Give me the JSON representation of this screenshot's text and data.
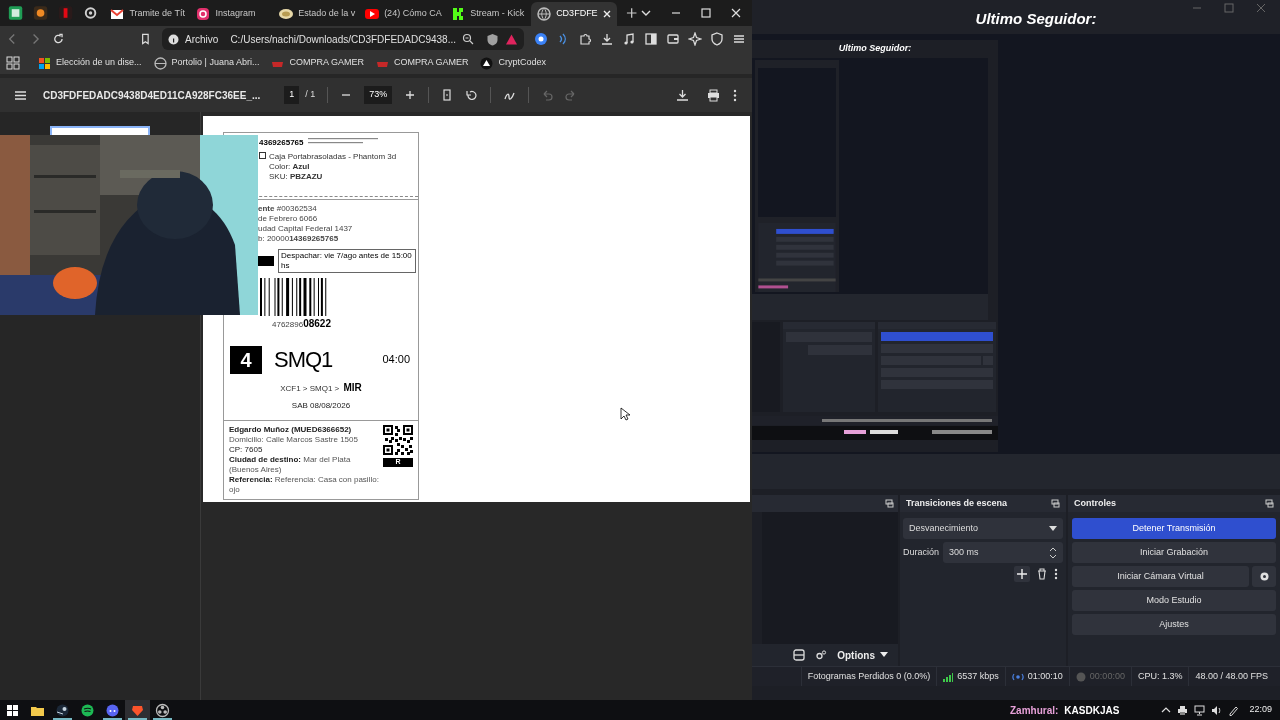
{
  "browser": {
    "tabs": [
      {
        "title": "Tramite de Tít",
        "selected": false
      },
      {
        "title": "Instagram",
        "selected": false
      },
      {
        "title": "Estado de la v",
        "selected": false
      },
      {
        "title": "(24) Cómo CA",
        "selected": false
      },
      {
        "title": "Stream - Kick",
        "selected": false
      },
      {
        "title": "CD3FDFE",
        "selected": true
      }
    ],
    "address": {
      "scheme": "Archivo",
      "url": "C:/Users/nachi/Downloads/CD3FDFEDADC9438..."
    },
    "bookmarks": [
      {
        "title": "Elección de un dise..."
      },
      {
        "title": "Portolio | Juana Abri..."
      },
      {
        "title": "COMPRA GAMER"
      },
      {
        "title": "COMPRA GAMER"
      },
      {
        "title": "CryptCodex"
      }
    ],
    "pdf_toolbar": {
      "title": "CD3FDFEDADC9438D4ED11CA928FC36EE_...",
      "page": "1",
      "page_of": "/ 1",
      "zoom": "73%"
    },
    "label": {
      "order_number": "4369265765",
      "item_checked": false,
      "item_name": "Caja Portabrasoladas - Phantom 3d",
      "item_color": "Color: **Azul**",
      "item_sku": "SKU: **PBZAZU**",
      "sender_lines": [
        "**ente** #00362534",
        "de Febrero 6066",
        "udad Capital Federal 1437",
        "b: 20000**14369265765**"
      ],
      "dispatch": "Despachar: vie 7/ago antes de 15:00 hs",
      "barcode_number": "4762896**08622**",
      "zone": "4",
      "route_code": "SMQ1",
      "time": "04:00",
      "route_path": "XCF1 > SMQ1 > **MIR**",
      "date": "SAB 08/08/2026",
      "recipient": "Edgardo Muñoz (MUED6366652)",
      "address": "Domicilio: Calle Marcos Sastre 1505",
      "cp": "CP: 7605",
      "city": "**Ciudad de destino:** Mar del Plata (Buenos Aires)",
      "reference": "**Referencia:** Referencia: Casa con pasillo: ojo",
      "sort_code": "R"
    }
  },
  "obs": {
    "title": "Ultimo Seguidor:",
    "nested": {
      "title": "Ultimo Seguidor:"
    },
    "docks": {
      "options": "Options",
      "transitions_title": "Transiciones de escena",
      "transition": "Desvanecimiento",
      "duration_label": "Duración",
      "duration": "300 ms",
      "controls_title": "Controles",
      "controls": [
        {
          "label": "Detener Transmisión",
          "kind": "primary"
        },
        {
          "label": "Iniciar Grabación",
          "kind": "plain"
        },
        {
          "label": "Iniciar Cámara Virtual",
          "kind": "with_settings"
        },
        {
          "label": "Modo Estudio",
          "kind": "plain"
        },
        {
          "label": "Ajustes",
          "kind": "plain"
        }
      ],
      "status": [
        {
          "text": "Fotogramas Perdidos 0 (0.0%)",
          "kind": "text"
        },
        {
          "text": "6537 kbps",
          "kind": "bitrate"
        },
        {
          "text": "01:00:10",
          "kind": "live"
        },
        {
          "text": "00:00:00",
          "kind": "rec"
        },
        {
          "text": "CPU: 1.3%",
          "kind": "text"
        },
        {
          "text": "48.00 / 48.00 FPS",
          "kind": "text"
        }
      ],
      "overlay_user": "Zamhural:",
      "overlay_message": "KASDKJAS",
      "clock": "22:09"
    }
  },
  "taskbar": {
    "apps": [
      {
        "running": false,
        "selected": false
      },
      {
        "running": false,
        "selected": false
      },
      {
        "running": true,
        "selected": false
      },
      {
        "running": false,
        "selected": false
      },
      {
        "running": true,
        "selected": false
      },
      {
        "running": true,
        "selected": true
      },
      {
        "running": true,
        "selected": false
      }
    ]
  }
}
